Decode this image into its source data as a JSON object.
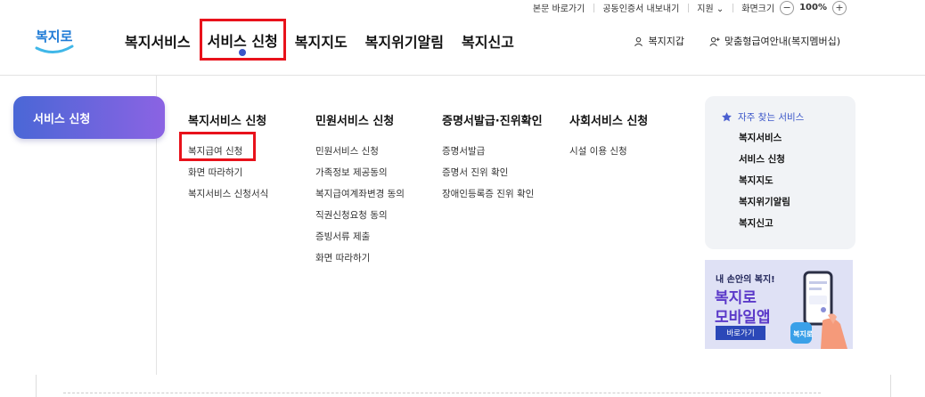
{
  "utility": {
    "skip": "본문 바로가기",
    "cert": "공동인증서 내보내기",
    "support": "지원",
    "zoom_label": "화면크기",
    "zoom_minus": "−",
    "zoom_value": "100%",
    "zoom_plus": "+"
  },
  "logo": {
    "text": "복지로"
  },
  "gnb": {
    "items": [
      {
        "label": "복지서비스"
      },
      {
        "label": "서비스 신청"
      },
      {
        "label": "복지지도"
      },
      {
        "label": "복지위기알림"
      },
      {
        "label": "복지신고"
      }
    ]
  },
  "header_right": {
    "wallet": "복지지갑",
    "membership": "맞춤형급여안내(복지멤버십)"
  },
  "mega": {
    "side_active": "서비스 신청",
    "columns": [
      {
        "title": "복지서비스 신청",
        "items": [
          "복지급여 신청",
          "화면 따라하기",
          "복지서비스 신청서식"
        ]
      },
      {
        "title": "민원서비스 신청",
        "items": [
          "민원서비스 신청",
          "가족정보 제공동의",
          "복지급여계좌변경 동의",
          "직권신청요청 동의",
          "증빙서류 제출",
          "화면 따라하기"
        ]
      },
      {
        "title": "증명서발급·진위확인",
        "items": [
          "증명서발급",
          "증명서 진위 확인",
          "장애인등록증 진위 확인"
        ]
      },
      {
        "title": "사회서비스 신청",
        "items": [
          "시설 이용 신청"
        ]
      }
    ],
    "favorites": {
      "title": "자주 찾는 서비스",
      "items": [
        "복지서비스",
        "서비스 신청",
        "복지지도",
        "복지위기알림",
        "복지신고"
      ]
    },
    "banner": {
      "small": "내 손안의 복지!",
      "line1": "복지로",
      "line2": "모바일앱",
      "button": "바로가기",
      "app_icon_text": "복지로"
    }
  },
  "colors": {
    "accent": "#3b56c8",
    "highlight": "#e8121b",
    "pill_start": "#4a67d6",
    "pill_end": "#8b63e3"
  }
}
